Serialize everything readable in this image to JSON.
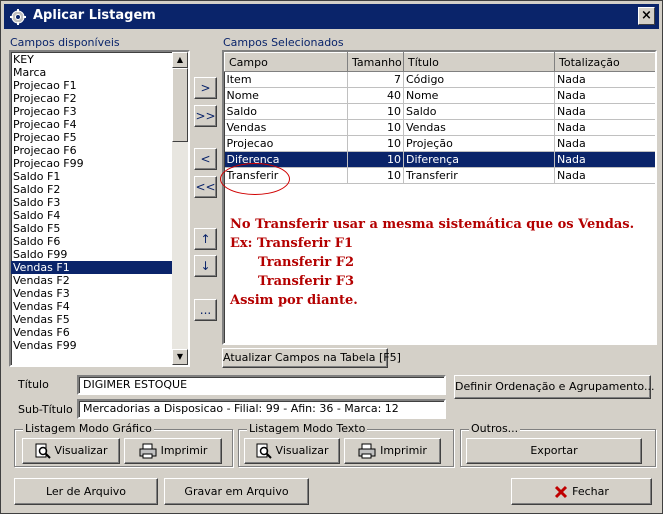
{
  "window": {
    "title": "Aplicar Listagem",
    "close": "×"
  },
  "available": {
    "label": "Campos disponíveis",
    "items": [
      "KEY",
      "Marca",
      "Projecao F1",
      "Projecao F2",
      "Projecao F3",
      "Projecao F4",
      "Projecao F5",
      "Projecao F6",
      "Projecao F99",
      "Saldo F1",
      "Saldo F2",
      "Saldo F3",
      "Saldo F4",
      "Saldo F5",
      "Saldo F6",
      "Saldo F99",
      "Vendas F1",
      "Vendas F2",
      "Vendas F3",
      "Vendas F4",
      "Vendas F5",
      "Vendas F6",
      "Vendas F99"
    ],
    "selected_item": "Vendas F1"
  },
  "move_buttons": {
    "add": ">",
    "add_all": ">>",
    "remove": "<",
    "remove_all": "<<",
    "up": "↑",
    "down": "↓",
    "more": "..."
  },
  "selected": {
    "label": "Campos Selecionados",
    "columns": [
      "Campo",
      "Tamanho",
      "Título",
      "Totalização"
    ],
    "rows": [
      [
        "Item",
        "7",
        "Código",
        "Nada"
      ],
      [
        "Nome",
        "40",
        "Nome",
        "Nada"
      ],
      [
        "Saldo",
        "10",
        "Saldo",
        "Nada"
      ],
      [
        "Vendas",
        "10",
        "Vendas",
        "Nada"
      ],
      [
        "Projecao",
        "10",
        "Projeção",
        "Nada"
      ],
      [
        "Diferenca",
        "10",
        "Diferença",
        "Nada"
      ],
      [
        "Transferir",
        "10",
        "Transferir",
        "Nada"
      ]
    ],
    "selected_row": "Diferenca"
  },
  "annotation": {
    "line1": "No Transferir usar a mesma sistemática que os Vendas.",
    "line2": "Ex: Transferir F1",
    "line3": "Transferir F2",
    "line4": "Transferir F3",
    "line5": "Assim por diante."
  },
  "update_button": "Atualizar Campos na Tabela [F5]",
  "titulo": {
    "label": "Título",
    "value": "DIGIMER ESTOQUE"
  },
  "subtitulo": {
    "label": "Sub-Título",
    "value": "Mercadorias a Disposicao - Filial: 99 - Afin: 36 - Marca: 12"
  },
  "ordering_button": "Definir Ordenação e Agrupamento...",
  "grafico": {
    "title": "Listagem Modo Gráfico",
    "view": "Visualizar",
    "print": "Imprimir"
  },
  "texto": {
    "title": "Listagem Modo Texto",
    "view": "Visualizar",
    "print": "Imprimir"
  },
  "outros": {
    "title": "Outros...",
    "export": "Exportar"
  },
  "bottom": {
    "load": "Ler de Arquivo",
    "save": "Gravar em Arquivo",
    "close": "Fechar"
  },
  "colors": {
    "titlebar": "#0a246a",
    "selection": "#0a246a",
    "annotation": "#b40000",
    "face": "#d4d0c8"
  }
}
